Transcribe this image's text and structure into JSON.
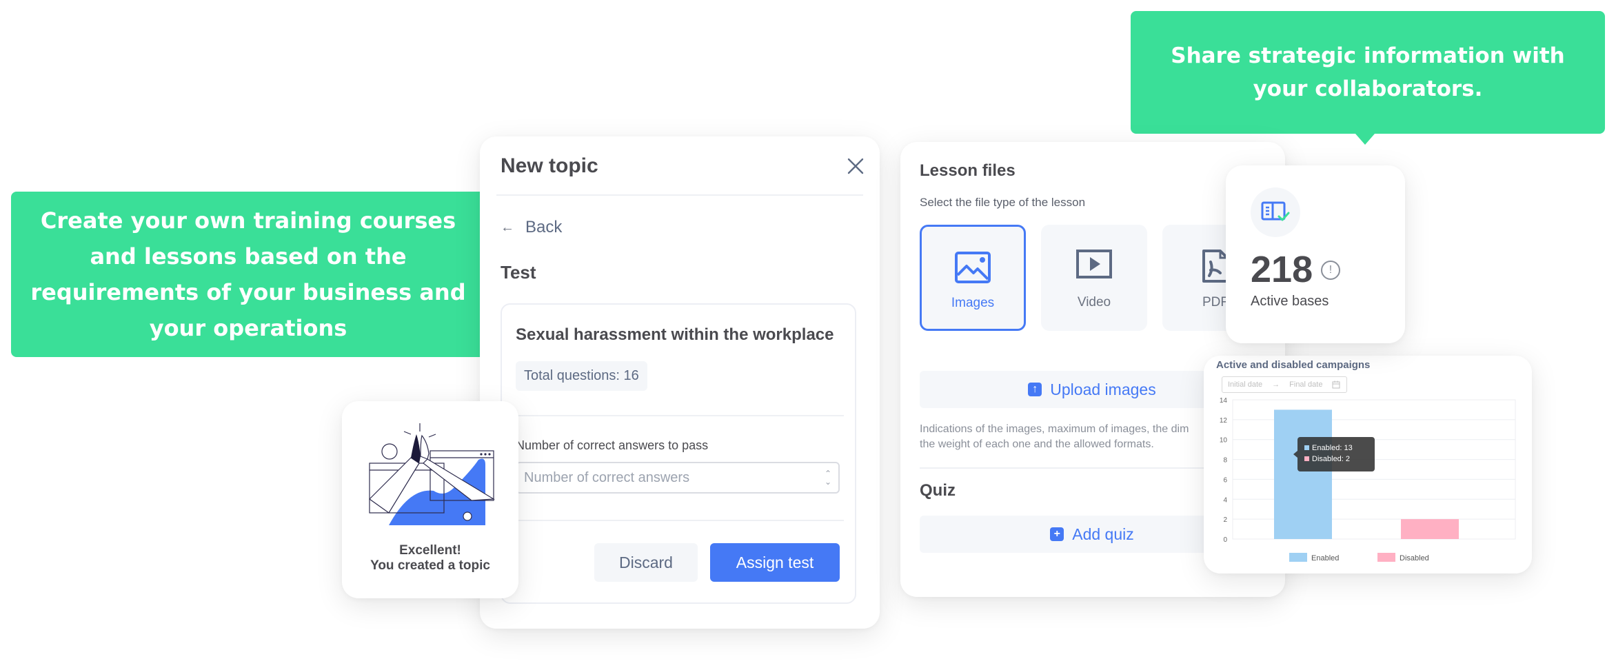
{
  "callouts": {
    "left": "Create your own training courses and lessons based on the requirements of your business and your operations",
    "top": "Share strategic information with your collaborators."
  },
  "colors": {
    "callout_green": "#3adf98",
    "primary_blue": "#4579f5",
    "enabled_bar": "#9fd0f3",
    "disabled_bar": "#ffb0c3"
  },
  "new_topic": {
    "title": "New topic",
    "close_icon": "close-icon",
    "back_label": "Back",
    "back_icon": "arrow-left-icon",
    "section_title": "Test",
    "test_name": "Sexual harassment within the workplace",
    "total_questions": "Total questions: 16",
    "pass_label": "Number of correct answers to pass",
    "pass_placeholder": "Number of correct answers",
    "discard_label": "Discard",
    "assign_label": "Assign test"
  },
  "success": {
    "line1": "Excellent!",
    "line2": "You created a topic",
    "illustration": "high-five-illustration"
  },
  "lesson_files": {
    "title": "Lesson files",
    "subtitle": "Select the file type of the lesson",
    "file_types": [
      {
        "label": "Images",
        "icon": "image-icon",
        "selected": true
      },
      {
        "label": "Video",
        "icon": "video-icon",
        "selected": false
      },
      {
        "label": "PDF",
        "icon": "pdf-icon",
        "selected": false
      }
    ],
    "upload_label": "Upload images",
    "hint": "Indications of the images, maximum of images, the dimensions, the weight of each one and the allowed formats.",
    "hint_line1": "Indications of the images, maximum of images, the dim",
    "hint_line2": "the weight of each one and the allowed formats.",
    "quiz_title": "Quiz",
    "add_quiz_label": "Add quiz"
  },
  "stat": {
    "value": "218",
    "label": "Active bases",
    "icon": "book-check-icon"
  },
  "chart": {
    "date_start_placeholder": "Initial date",
    "date_end_placeholder": "Final date",
    "tooltip_enabled": "Enabled: 13",
    "tooltip_disabled": "Disabled: 2"
  },
  "chart_data": {
    "type": "bar",
    "title": "Active and disabled campaigns",
    "categories": [
      "Enabled",
      "Disabled"
    ],
    "values": [
      13,
      2
    ],
    "series": [
      {
        "name": "Enabled",
        "values": [
          13
        ],
        "color": "#9fd0f3"
      },
      {
        "name": "Disabled",
        "values": [
          2
        ],
        "color": "#ffb0c3"
      }
    ],
    "xlabel": "",
    "ylabel": "",
    "ylim": [
      0,
      14
    ],
    "yticks": [
      0,
      2,
      4,
      6,
      8,
      10,
      12,
      14
    ],
    "grid": true,
    "legend": "bottom"
  }
}
